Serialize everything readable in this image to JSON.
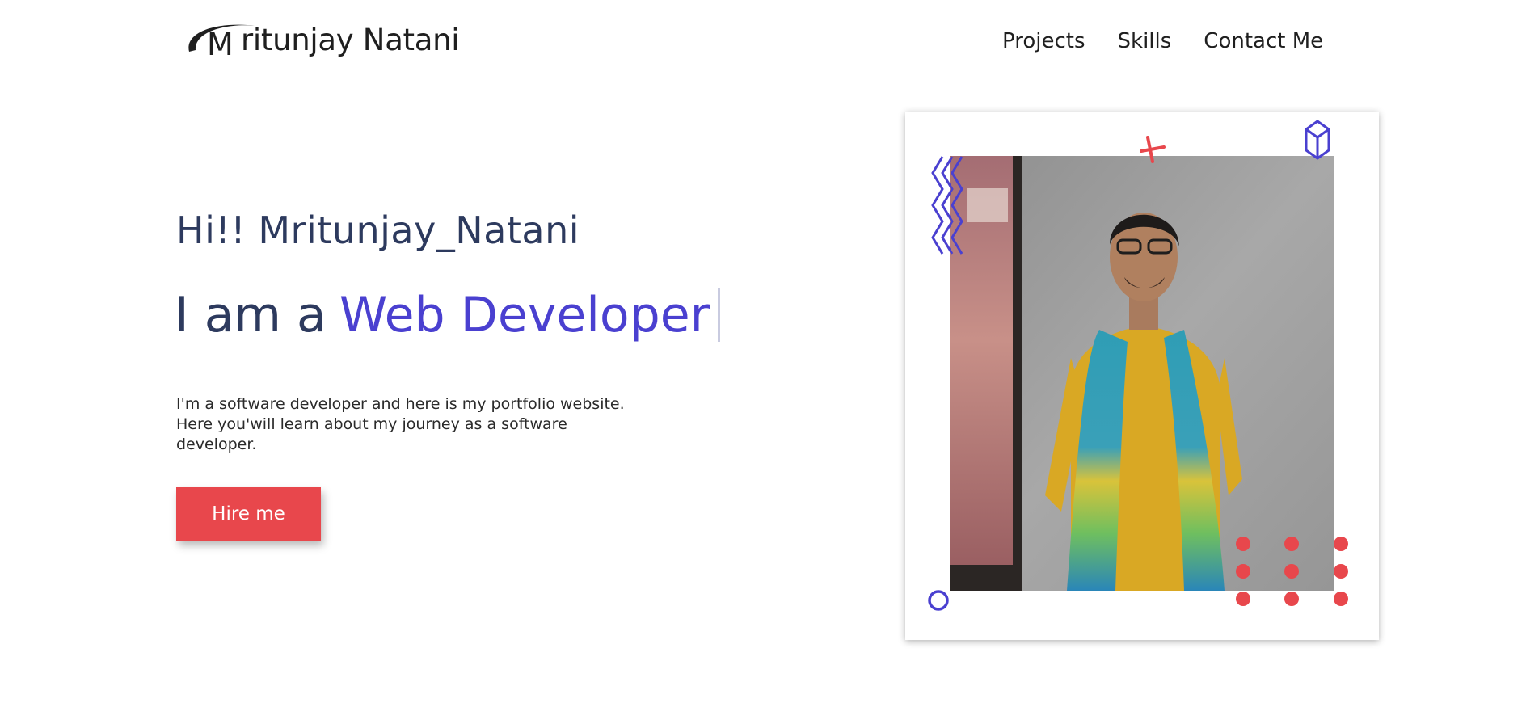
{
  "header": {
    "logo_letter": "M",
    "logo_text": "ritunjay Natani",
    "nav": [
      "Projects",
      "Skills",
      "Contact Me"
    ]
  },
  "hero": {
    "greeting": "Hi!! Mritunjay_Natani",
    "role_prefix": "I am a",
    "role": "Web Developer",
    "intro": "I'm a software developer and here is my portfolio website. Here you'will learn about my journey as a software developer.",
    "hire_label": "Hire me"
  },
  "colors": {
    "accent_purple": "#4a40d0",
    "accent_red": "#e8474c",
    "heading": "#2d3a5e"
  },
  "icons": [
    "logo-swoosh-icon",
    "zigzag-icon",
    "cross-icon",
    "cube-icon",
    "circle-icon",
    "dots-grid-icon"
  ]
}
